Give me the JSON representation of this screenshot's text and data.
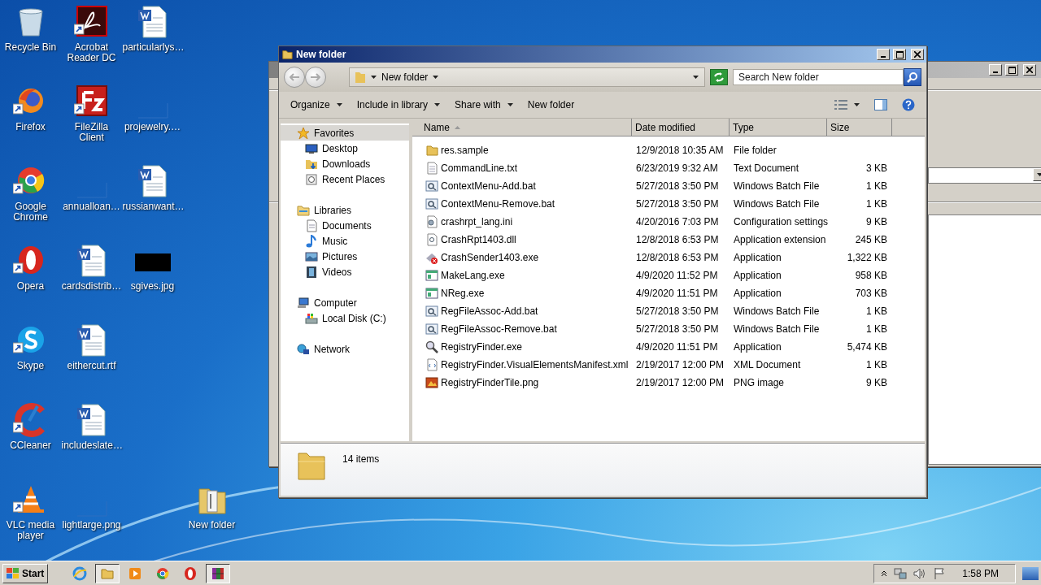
{
  "desktop": {
    "icons": [
      {
        "label": "Recycle Bin",
        "kind": "recycle-bin",
        "shortcut": false
      },
      {
        "label": "Firefox",
        "kind": "app",
        "shortcut": true
      },
      {
        "label": "Google Chrome",
        "kind": "app",
        "shortcut": true
      },
      {
        "label": "Opera",
        "kind": "app",
        "shortcut": true
      },
      {
        "label": "Skype",
        "kind": "app",
        "shortcut": true
      },
      {
        "label": "CCleaner",
        "kind": "app",
        "shortcut": true
      },
      {
        "label": "VLC media player",
        "kind": "app",
        "shortcut": true
      },
      {
        "label": "Acrobat Reader DC",
        "kind": "app",
        "shortcut": true
      },
      {
        "label": "FileZilla Client",
        "kind": "app",
        "shortcut": true
      },
      {
        "label": "annualloan…",
        "kind": "blank",
        "shortcut": false
      },
      {
        "label": "cardsdistrib…",
        "kind": "document",
        "shortcut": false
      },
      {
        "label": "eithercut.rtf",
        "kind": "document",
        "shortcut": false
      },
      {
        "label": "includeslate…",
        "kind": "document",
        "shortcut": false
      },
      {
        "label": "lightlarge.png",
        "kind": "blank",
        "shortcut": false
      },
      {
        "label": "particularlys…",
        "kind": "document",
        "shortcut": false
      },
      {
        "label": "projewelry.…",
        "kind": "blank",
        "shortcut": false
      },
      {
        "label": "russianwant…",
        "kind": "document",
        "shortcut": false
      },
      {
        "label": "sgives.jpg",
        "kind": "image",
        "shortcut": false
      }
    ],
    "dropped_item": {
      "label": "New folder",
      "kind": "folder"
    }
  },
  "explorer": {
    "title": "New folder",
    "address": "New folder",
    "search": {
      "placeholder": "Search New folder"
    },
    "toolbar": [
      {
        "label": "Organize",
        "dropdown": true
      },
      {
        "label": "Include in library",
        "dropdown": true
      },
      {
        "label": "Share with",
        "dropdown": true
      },
      {
        "label": "New folder",
        "dropdown": false
      }
    ],
    "navigation": [
      {
        "label": "Favorites",
        "kind": "favorites",
        "selected": true,
        "children": [
          {
            "label": "Desktop",
            "kind": "desktop",
            "selected": false
          },
          {
            "label": "Downloads",
            "kind": "downloads",
            "selected": false
          },
          {
            "label": "Recent Places",
            "kind": "recent",
            "selected": false
          }
        ]
      },
      {
        "label": "Libraries",
        "kind": "libraries",
        "selected": false,
        "children": [
          {
            "label": "Documents",
            "kind": "documents",
            "selected": false
          },
          {
            "label": "Music",
            "kind": "music",
            "selected": false
          },
          {
            "label": "Pictures",
            "kind": "pictures",
            "selected": false
          },
          {
            "label": "Videos",
            "kind": "videos",
            "selected": false
          }
        ]
      },
      {
        "label": "Computer",
        "kind": "computer",
        "selected": false,
        "children": [
          {
            "label": "Local Disk (C:)",
            "kind": "disk",
            "selected": false
          }
        ]
      },
      {
        "label": "Network",
        "kind": "network",
        "selected": false
      }
    ],
    "columns": [
      "Name",
      "Date modified",
      "Type",
      "Size"
    ],
    "rows": [
      {
        "name": "res.sample",
        "date": "12/9/2018 10:35 AM",
        "type": "File folder",
        "size": "",
        "kind": "folder"
      },
      {
        "name": "CommandLine.txt",
        "date": "6/23/2019 9:32 AM",
        "type": "Text Document",
        "size": "3 KB",
        "kind": "text"
      },
      {
        "name": "ContextMenu-Add.bat",
        "date": "5/27/2018 3:50 PM",
        "type": "Windows Batch File",
        "size": "1 KB",
        "kind": "batch"
      },
      {
        "name": "ContextMenu-Remove.bat",
        "date": "5/27/2018 3:50 PM",
        "type": "Windows Batch File",
        "size": "1 KB",
        "kind": "batch"
      },
      {
        "name": "crashrpt_lang.ini",
        "date": "4/20/2016 7:03 PM",
        "type": "Configuration settings",
        "size": "9 KB",
        "kind": "settings"
      },
      {
        "name": "CrashRpt1403.dll",
        "date": "12/8/2018 6:53 PM",
        "type": "Application extension",
        "size": "245 KB",
        "kind": "library"
      },
      {
        "name": "CrashSender1403.exe",
        "date": "12/8/2018 6:53 PM",
        "type": "Application",
        "size": "1,322 KB",
        "kind": "error-app"
      },
      {
        "name": "MakeLang.exe",
        "date": "4/9/2020 11:52 PM",
        "type": "Application",
        "size": "958 KB",
        "kind": "app"
      },
      {
        "name": "NReg.exe",
        "date": "4/9/2020 11:51 PM",
        "type": "Application",
        "size": "703 KB",
        "kind": "app"
      },
      {
        "name": "RegFileAssoc-Add.bat",
        "date": "5/27/2018 3:50 PM",
        "type": "Windows Batch File",
        "size": "1 KB",
        "kind": "batch"
      },
      {
        "name": "RegFileAssoc-Remove.bat",
        "date": "5/27/2018 3:50 PM",
        "type": "Windows Batch File",
        "size": "1 KB",
        "kind": "batch"
      },
      {
        "name": "RegistryFinder.exe",
        "date": "4/9/2020 11:51 PM",
        "type": "Application",
        "size": "5,474 KB",
        "kind": "magnifier"
      },
      {
        "name": "RegistryFinder.VisualElementsManifest.xml",
        "date": "2/19/2017 12:00 PM",
        "type": "XML Document",
        "size": "1 KB",
        "kind": "xml"
      },
      {
        "name": "RegistryFinderTile.png",
        "date": "2/19/2017 12:00 PM",
        "type": "PNG image",
        "size": "9 KB",
        "kind": "image"
      }
    ],
    "status": "14 items"
  },
  "taskbar": {
    "start": "Start",
    "buttons": [
      {
        "kind": "ie",
        "selected": false
      },
      {
        "kind": "explorer",
        "selected": true
      },
      {
        "kind": "media",
        "selected": false
      },
      {
        "kind": "chrome",
        "selected": false
      },
      {
        "kind": "opera",
        "selected": false
      },
      {
        "kind": "winrar",
        "selected": true
      }
    ],
    "clock": "1:58 PM"
  }
}
